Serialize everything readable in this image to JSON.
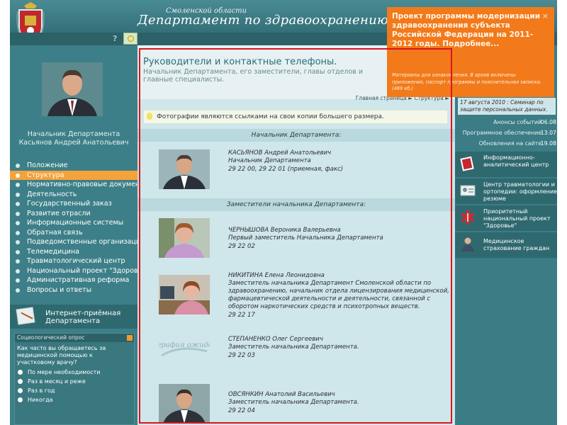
{
  "header": {
    "region": "Смоленской области",
    "department": "Департамент по здравоохранению",
    "help": "?"
  },
  "chief": {
    "caption_line1": "Начальник Департамента",
    "caption_line2": "Касьянов Андрей Анатольевич"
  },
  "menu": {
    "items": [
      {
        "label": "Положение"
      },
      {
        "label": "Структура"
      },
      {
        "label": "Нормативно-правовые документы"
      },
      {
        "label": "Деятельность"
      },
      {
        "label": "Государственный заказ"
      },
      {
        "label": "Развитие отрасли"
      },
      {
        "label": "Информационные системы"
      },
      {
        "label": "Обратная связь"
      },
      {
        "label": "Подведомственные организации"
      },
      {
        "label": "Телемедицина"
      },
      {
        "label": "Травматологический центр"
      },
      {
        "label": "Национальный проект \"Здоровье\""
      },
      {
        "label": "Административная реформа"
      },
      {
        "label": "Вопросы и ответы"
      }
    ],
    "active_label": "Структура"
  },
  "reception": {
    "line1": "Интернет-приёмная",
    "line2": "Департамента"
  },
  "poll": {
    "heading": "Социологический опрос",
    "question": "Как часто вы обращаетесь за медицинской помощью к участковому врачу?",
    "options": [
      "По мере необходимости",
      "Раз в месяц и реже",
      "Раз в год",
      "Никогда"
    ]
  },
  "main": {
    "title": "Руководители и контактные телефоны.",
    "subtitle": "Начальник Департамента, его заместители, главы отделов и главные специалисты.",
    "breadcrumb": "Главная страница ► Структура ►",
    "note": "Фотографии являются ссылками на свои копии большего размера.",
    "section_head": "Начальник Департамента:",
    "section_deputies": "Заместители начальника Департамента:",
    "people": [
      {
        "name": "КАСЬЯНОВ Андрей Анатольевич",
        "position": "Начальник Департамента",
        "phone": "29 22 00, 29 22 01 (приемная, факс)"
      },
      {
        "name": "ЧЕРНЫШОВА Вероника Валерьевна",
        "position": "Первый заместитель Начальника Департамента",
        "phone": "29 22 02"
      },
      {
        "name": "НИКИТИНА Елена Леонидовна",
        "position": "Заместитель начальника Департамент Смоленской области по здравоохранению, начальник отдела лицензирования медицинской, фармацевтической деятельности и деятельности, связанной с оборотом наркотических средств и психотропных веществ.",
        "phone": "29 22 17"
      },
      {
        "name": "СТЕПАНЕНКО Олег Сергеевич",
        "position": "Заместитель начальника Департамента.",
        "phone": "29 22 03",
        "photo_placeholder": "Фотография ожидается"
      },
      {
        "name": "ОВСЯНКИН Анатолий Васильевич",
        "position": "Заместитель начальника Департамента.",
        "phone": "29 22 04"
      }
    ]
  },
  "right": {
    "news_tail": "17 августа 2010 : Семинар по защите персональных данных.",
    "stats": [
      {
        "label": "Анонсы событий",
        "value": "06.08"
      },
      {
        "label": "Программное обеспечение",
        "value": "13.07"
      },
      {
        "label": "Обновления на сайте",
        "value": "19.08"
      }
    ],
    "links": [
      {
        "label": "Информационно-аналитический центр",
        "icon": "book-icon"
      },
      {
        "label": "Центр травматологии и ортопедии: оформление резюме",
        "icon": "id-card-icon"
      },
      {
        "label": "Приоритетный национальный проект \"Здоровье\"",
        "icon": "medical-star-icon"
      },
      {
        "label": "Медицинское страхование граждан",
        "icon": "person-icon"
      }
    ]
  },
  "popup": {
    "title": "Проект программы модернизации здравоохранения субъекта Российской Федерации на 2011-2012 годы. Подробнее...",
    "text": "Материалы для ознакомления. В архив включены приложения, паспорт программы и пояснительная записка. (469 кб.)",
    "close": "×"
  },
  "colors": {
    "accent": "#f27a1a",
    "teal": "#3b7c85",
    "highlight": "#d9161e"
  }
}
